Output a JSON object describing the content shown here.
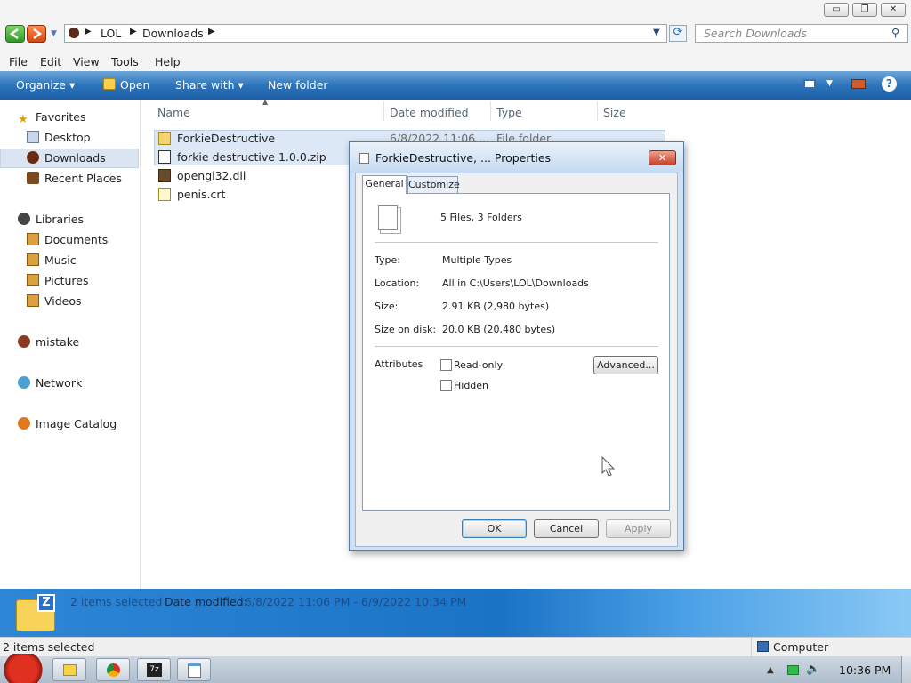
{
  "window": {
    "breadcrumb": [
      "LOL",
      "Downloads"
    ],
    "search_placeholder": "Search Downloads",
    "controls": {
      "minimize": "▭",
      "maximize": "❐",
      "close": "✕"
    }
  },
  "menu": [
    "File",
    "Edit",
    "View",
    "Tools",
    "Help"
  ],
  "toolbar": {
    "organize": "Organize ▾",
    "open": "Open",
    "share": "Share with ▾",
    "new_folder": "New folder"
  },
  "nav": {
    "favorites": "Favorites",
    "desktop": "Desktop",
    "downloads": "Downloads",
    "recent": "Recent Places",
    "libraries": "Libraries",
    "documents": "Documents",
    "music": "Music",
    "pictures": "Pictures",
    "videos": "Videos",
    "mistake": "mistake",
    "network": "Network",
    "catalog": "Image Catalog"
  },
  "columns": {
    "name": "Name",
    "date": "Date modified",
    "type": "Type",
    "size": "Size"
  },
  "files": [
    {
      "name": "ForkieDestructive",
      "date": "6/8/2022 11:06 ...",
      "type": "File folder"
    },
    {
      "name": "forkie destructive 1.0.0.zip",
      "date": "",
      "type": ""
    },
    {
      "name": "opengl32.dll",
      "date": "",
      "type": ""
    },
    {
      "name": "penis.crt",
      "date": "",
      "type": ""
    }
  ],
  "details": {
    "selected": "2 items selected",
    "date_label": "Date modified:",
    "date_value": "6/8/2022 11:06 PM - 6/9/2022 10:34 PM"
  },
  "status": {
    "left": "2 items selected",
    "right": "Computer"
  },
  "taskbar": {
    "time": "10:36 PM"
  },
  "dialog": {
    "title": "ForkieDestructive, ... Properties",
    "close": "✕",
    "tabs": [
      "General",
      "Customize"
    ],
    "summary": "5 Files, 3 Folders",
    "type_label": "Type:",
    "type_value": "Multiple Types",
    "location_label": "Location:",
    "location_value": "All in C:\\Users\\LOL\\Downloads",
    "size_label": "Size:",
    "size_value": "2.91 KB (2,980 bytes)",
    "disk_label": "Size on disk:",
    "disk_value": "20.0 KB (20,480 bytes)",
    "attributes_label": "Attributes",
    "readonly": "Read-only",
    "hidden": "Hidden",
    "advanced": "Advanced...",
    "ok": "OK",
    "cancel": "Cancel",
    "apply": "Apply"
  }
}
